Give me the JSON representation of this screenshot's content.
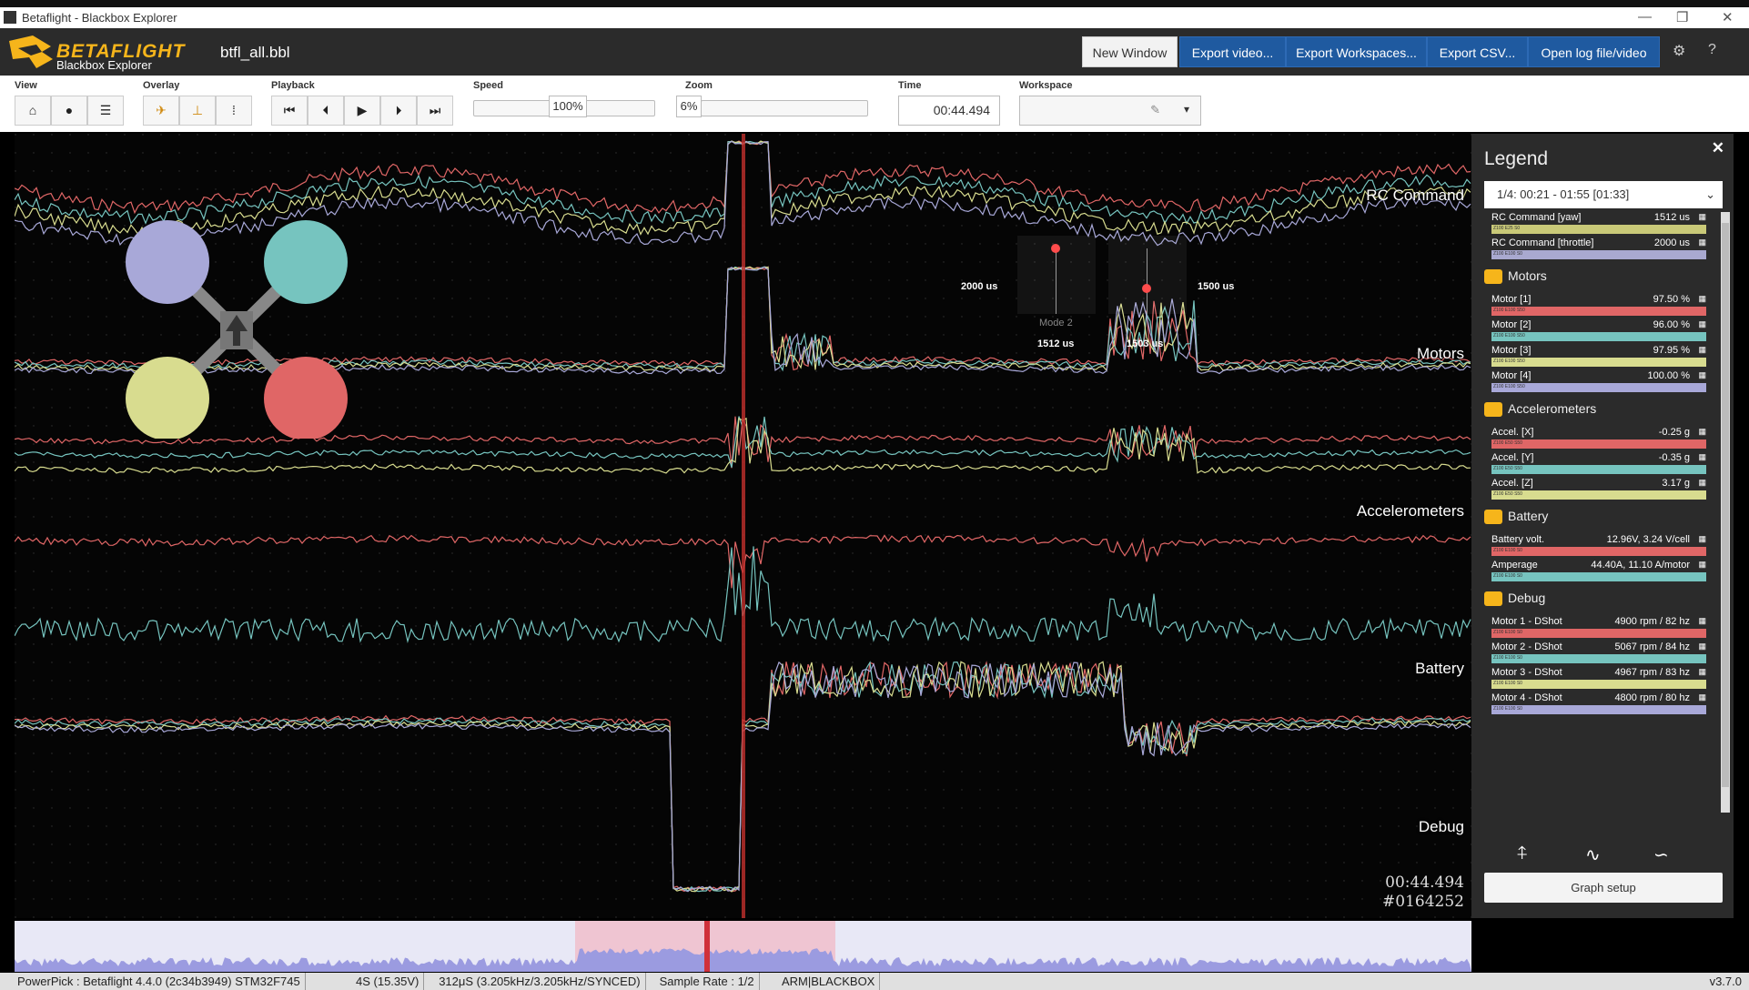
{
  "window": {
    "title": "Betaflight - Blackbox Explorer",
    "controls": [
      "—",
      "❐",
      "✕"
    ]
  },
  "header": {
    "brand": "BETAFLIGHT",
    "brand_sub": "Blackbox Explorer",
    "filename": "btfl_all.bbl",
    "buttons": {
      "new_window": "New Window",
      "export_video": "Export video...",
      "export_workspaces": "Export Workspaces...",
      "export_csv": "Export CSV...",
      "open_log": "Open log file/video"
    }
  },
  "toolbar": {
    "groups": {
      "view": "View",
      "overlay": "Overlay",
      "playback": "Playback",
      "speed": "Speed",
      "zoom": "Zoom",
      "time": "Time",
      "workspace": "Workspace"
    },
    "speed_value": "100%",
    "zoom_value": "6%",
    "time_value": "00:44.494",
    "accent": "#1f5aa0"
  },
  "graph": {
    "labels": {
      "rc": "RC Command",
      "motors": "Motors",
      "accel": "Accelerometers",
      "battery": "Battery",
      "debug": "Debug"
    },
    "sticks": {
      "left_top": "2000 us",
      "right_top": "1500 us",
      "left_bottom": "1512 us",
      "right_bottom": "1503 us",
      "mode": "Mode 2"
    },
    "timestamp": "00:44.494",
    "frame": "#0164252"
  },
  "legend": {
    "title": "Legend",
    "close": "✕",
    "selector": "1/4: 00:21 - 01:55 [01:33]",
    "rc_rows": [
      {
        "name": "RC Command [yaw]",
        "value": "1512 us",
        "scale": "Z100 E25 S0",
        "color": "#c9c978"
      },
      {
        "name": "RC Command [throttle]",
        "value": "2000 us",
        "scale": "Z100 E100 S0",
        "color": "#a9a9d0"
      }
    ],
    "sections": {
      "motors": "Motors",
      "accel": "Accelerometers",
      "battery": "Battery",
      "debug": "Debug"
    },
    "motors": [
      {
        "name": "Motor [1]",
        "value": "97.50 %",
        "scale": "Z100 E100 S50",
        "color": "#e06666"
      },
      {
        "name": "Motor [2]",
        "value": "96.00 %",
        "scale": "Z100 E100 S50",
        "color": "#76c4bf"
      },
      {
        "name": "Motor [3]",
        "value": "97.95 %",
        "scale": "Z100 E100 S50",
        "color": "#d8dc8f"
      },
      {
        "name": "Motor [4]",
        "value": "100.00 %",
        "scale": "Z100 E100 S50",
        "color": "#a8a8d8"
      }
    ],
    "accel": [
      {
        "name": "Accel. [X]",
        "value": "-0.25 g",
        "scale": "Z100 E50 S50",
        "color": "#e06666"
      },
      {
        "name": "Accel. [Y]",
        "value": "-0.35 g",
        "scale": "Z100 E50 S50",
        "color": "#76c4bf"
      },
      {
        "name": "Accel. [Z]",
        "value": "3.17 g",
        "scale": "Z100 E50 S50",
        "color": "#d8dc8f"
      }
    ],
    "battery": [
      {
        "name": "Battery volt.",
        "value": "12.96V, 3.24 V/cell",
        "scale": "Z100 E100 S0",
        "color": "#e06666"
      },
      {
        "name": "Amperage",
        "value": "44.40A, 11.10 A/motor",
        "scale": "Z100 E100 S0",
        "color": "#76c4bf"
      }
    ],
    "debug": [
      {
        "name": "Motor 1 - DShot",
        "value": "4900 rpm / 82 hz",
        "scale": "Z100 E100 S0",
        "color": "#e06666"
      },
      {
        "name": "Motor 2 - DShot",
        "value": "5067 rpm / 84 hz",
        "scale": "Z100 E100 S0",
        "color": "#76c4bf"
      },
      {
        "name": "Motor 3 - DShot",
        "value": "4967 rpm / 83 hz",
        "scale": "Z100 E100 S0",
        "color": "#d8dc8f"
      },
      {
        "name": "Motor 4 - DShot",
        "value": "4800 rpm / 80 hz",
        "scale": "Z100 E100 S0",
        "color": "#a8a8d8"
      }
    ],
    "graph_setup": "Graph setup"
  },
  "status": {
    "items": [
      "PowerPick : Betaflight 4.4.0 (2c34b3949) STM32F745",
      "4S (15.35V)",
      "312μS (3.205kHz/3.205kHz/SYNCED)",
      "Sample Rate : 1/2",
      "ARM|BLACKBOX"
    ],
    "version": "v3.7.0"
  }
}
